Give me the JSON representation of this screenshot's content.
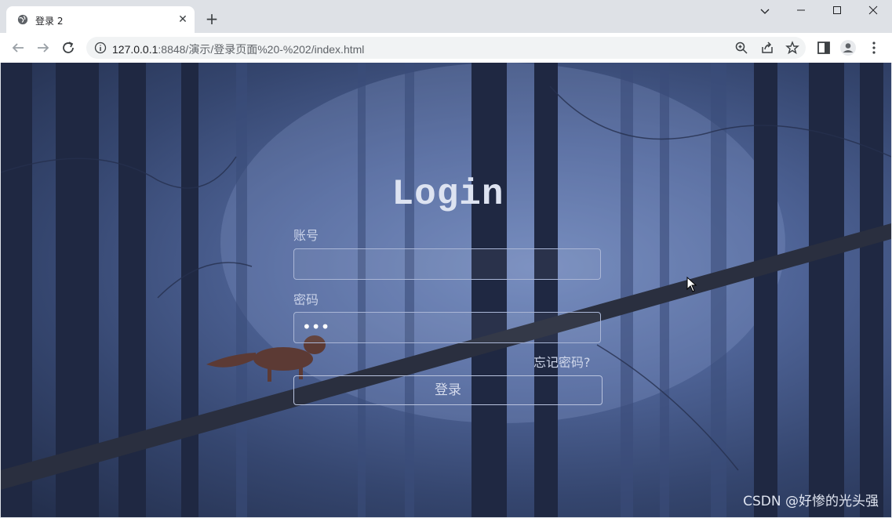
{
  "browser": {
    "tab": {
      "title": "登录 2",
      "close_glyph": "✕"
    },
    "new_tab_glyph": "+",
    "window_controls": {
      "dropdown": "⌄",
      "minimize": "—",
      "maximize": "☐",
      "close": "✕"
    },
    "address_bar": {
      "host": "127.0.0.1",
      "path": ":8848/演示/登录页面%20-%202/index.html"
    },
    "icons": [
      "back-icon",
      "forward-icon",
      "reload-icon",
      "info-icon",
      "zoom-icon",
      "share-icon",
      "bookmark-star-icon",
      "side-panel-icon",
      "profile-icon",
      "menu-icon"
    ]
  },
  "login": {
    "title": "Login",
    "account_label": "账号",
    "account_value": "",
    "password_label": "密码",
    "password_value": "•••",
    "forgot_link": "忘记密码?",
    "submit_label": "登录"
  },
  "watermark": "CSDN @好惨的光头强",
  "colors": {
    "background_accent": "#4e6396",
    "text_light": "#dde3f1",
    "input_border": "#aab6d6"
  }
}
